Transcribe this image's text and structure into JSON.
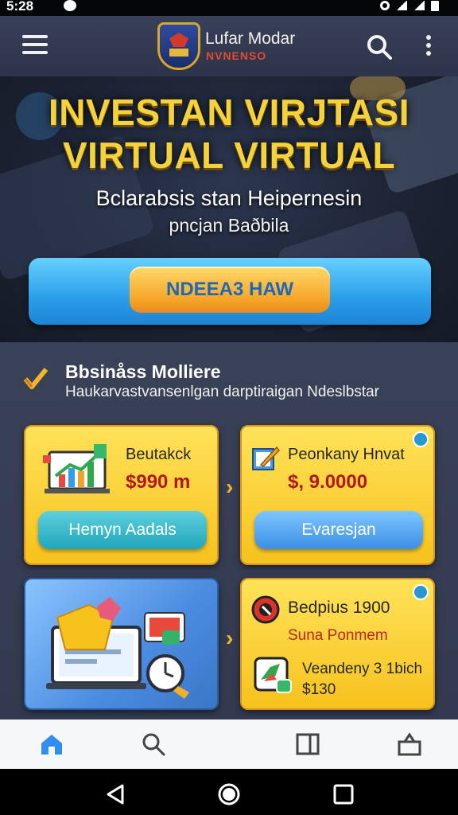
{
  "status_bar": {
    "time": "5:28"
  },
  "app_bar": {
    "title": "Lufar Modar",
    "subtitle": "NVNENSO",
    "menu_icon": "hamburger-menu-icon",
    "search_icon": "search-icon",
    "more_icon": "more-vert-icon"
  },
  "hero": {
    "title_line1": "INVESTAN VIRJTASI",
    "title_line2": "VIRTUAL VIRTUAL",
    "subtitle_line1": "Bclarabsis stan Heipernesin",
    "subtitle_line2": "pncjan Baðbila",
    "cta_label": "NDEEA3 HAW"
  },
  "section": {
    "title": "Bbsinåss Molliere",
    "description": "Haukarvastvansenlgan darptiraigan Ndeslbstar",
    "cards": [
      {
        "label": "Beutakck",
        "price": "$990 m",
        "button": "Hemyn Aadals",
        "icon": "growth-chart-icon"
      },
      {
        "label": "Peonkany Hnvat",
        "price": "$, 9.0000",
        "button": "Evaresjan",
        "icon": "edit-note-icon"
      },
      {
        "label": "",
        "icon": "laptop-gems-illustration"
      },
      {
        "label": "Bedpius 1900",
        "sub": "Suna Ponmem",
        "detail1": "Veandeny 3 1bich",
        "detail2": "$130",
        "icon": "badge-icon"
      }
    ]
  },
  "bottom_nav": [
    "home-icon",
    "search-icon",
    "tablet-icon",
    "bag-icon"
  ],
  "colors": {
    "accent_yellow": "#f6d23a",
    "price_red": "#b3171a",
    "cta_blue": "#2b9eea",
    "nav_active": "#2f8ef0"
  }
}
